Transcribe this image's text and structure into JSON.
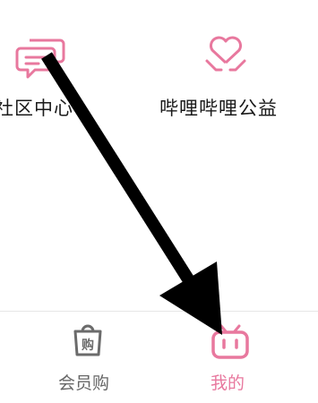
{
  "grid": {
    "items": [
      {
        "label": "社区中心",
        "icon": "chat-bubbles-icon"
      },
      {
        "label": "哔哩哔哩公益",
        "icon": "heart-hands-icon"
      }
    ]
  },
  "tabbar": {
    "items": [
      {
        "label": "会员购",
        "icon": "shopping-bag-icon",
        "active": false
      },
      {
        "label": "我的",
        "icon": "tv-face-icon",
        "active": true
      }
    ]
  },
  "colors": {
    "accent": "#e8789e",
    "icon_gray": "#6b6b6b",
    "text": "#1a1a1a",
    "tab_text": "#666666"
  }
}
